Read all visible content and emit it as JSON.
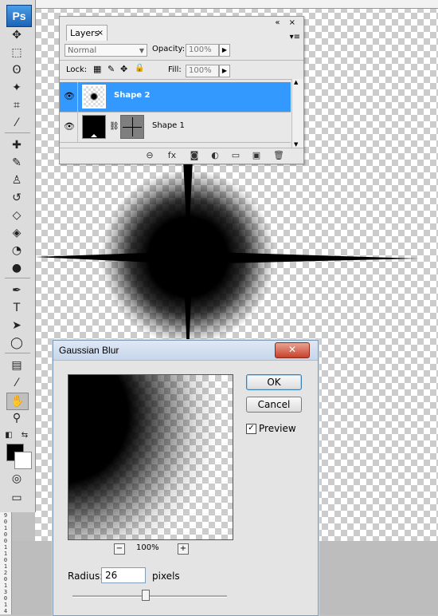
{
  "app": {
    "logo": "Ps"
  },
  "toolbar": {
    "tools": [
      {
        "name": "move-tool",
        "glyph": "✥"
      },
      {
        "name": "marquee-tool",
        "glyph": "⬚"
      },
      {
        "name": "lasso-tool",
        "glyph": "ʘ"
      },
      {
        "name": "magic-wand-tool",
        "glyph": "✦"
      },
      {
        "name": "crop-tool",
        "glyph": "⌗"
      },
      {
        "name": "eyedropper-tool",
        "glyph": "⁄"
      },
      {
        "name": "healing-brush-tool",
        "glyph": "✚"
      },
      {
        "name": "brush-tool",
        "glyph": "✎"
      },
      {
        "name": "clone-stamp-tool",
        "glyph": "♙"
      },
      {
        "name": "history-brush-tool",
        "glyph": "↺"
      },
      {
        "name": "eraser-tool",
        "glyph": "◇"
      },
      {
        "name": "paint-bucket-tool",
        "glyph": "◈"
      },
      {
        "name": "blur-tool",
        "glyph": "◔"
      },
      {
        "name": "dodge-tool",
        "glyph": "●"
      },
      {
        "name": "pen-tool",
        "glyph": "✒"
      },
      {
        "name": "type-tool",
        "glyph": "T"
      },
      {
        "name": "path-selection-tool",
        "glyph": "➤"
      },
      {
        "name": "ellipse-tool",
        "glyph": "◯"
      },
      {
        "name": "notes-tool",
        "glyph": "▤"
      },
      {
        "name": "color-sampler-tool",
        "glyph": "⁄"
      },
      {
        "name": "hand-tool",
        "glyph": "✋"
      },
      {
        "name": "zoom-tool",
        "glyph": "⚲"
      }
    ],
    "foreground_color": "#000000",
    "background_color": "#ffffff",
    "swap_glyph": "⇆",
    "default_colors_glyph": "◧",
    "quick_mask_glyph": "◎",
    "screen_mode_glyph": "▭"
  },
  "ruler": {
    "vertical_marks": [
      "9",
      "0",
      "1",
      "0",
      "0",
      "1",
      "1",
      "0",
      "1",
      "2",
      "0",
      "1",
      "3",
      "0",
      "1",
      "4"
    ]
  },
  "layers_panel": {
    "tab_label": "Layers",
    "tab_close": "×",
    "window_controls": "« ×",
    "menu_glyph": "▾≡",
    "blend_mode": "Normal",
    "opacity_label": "Opacity:",
    "opacity_value": "100%",
    "lock_label": "Lock:",
    "fill_label": "Fill:",
    "fill_value": "100%",
    "layers": [
      {
        "name": "Shape 2",
        "selected": true
      },
      {
        "name": "Shape 1",
        "selected": false
      }
    ],
    "bottom_icons": [
      "link-icon",
      "fx-icon",
      "mask-icon",
      "adjustment-icon",
      "group-icon",
      "new-layer-icon",
      "trash-icon"
    ],
    "bottom_glyphs": [
      "⊖",
      "fx",
      "◙",
      "◐",
      "▭",
      "▣",
      "🗑"
    ]
  },
  "dialog": {
    "title": "Gaussian Blur",
    "close_glyph": "✕",
    "ok_label": "OK",
    "cancel_label": "Cancel",
    "preview_label": "Preview",
    "preview_checked": true,
    "check_glyph": "✓",
    "zoom_out": "−",
    "zoom_in": "+",
    "zoom_level": "100%",
    "radius_label": "Radius:",
    "radius_value": "26",
    "radius_unit": "pixels",
    "slider_fraction": 0.47
  }
}
